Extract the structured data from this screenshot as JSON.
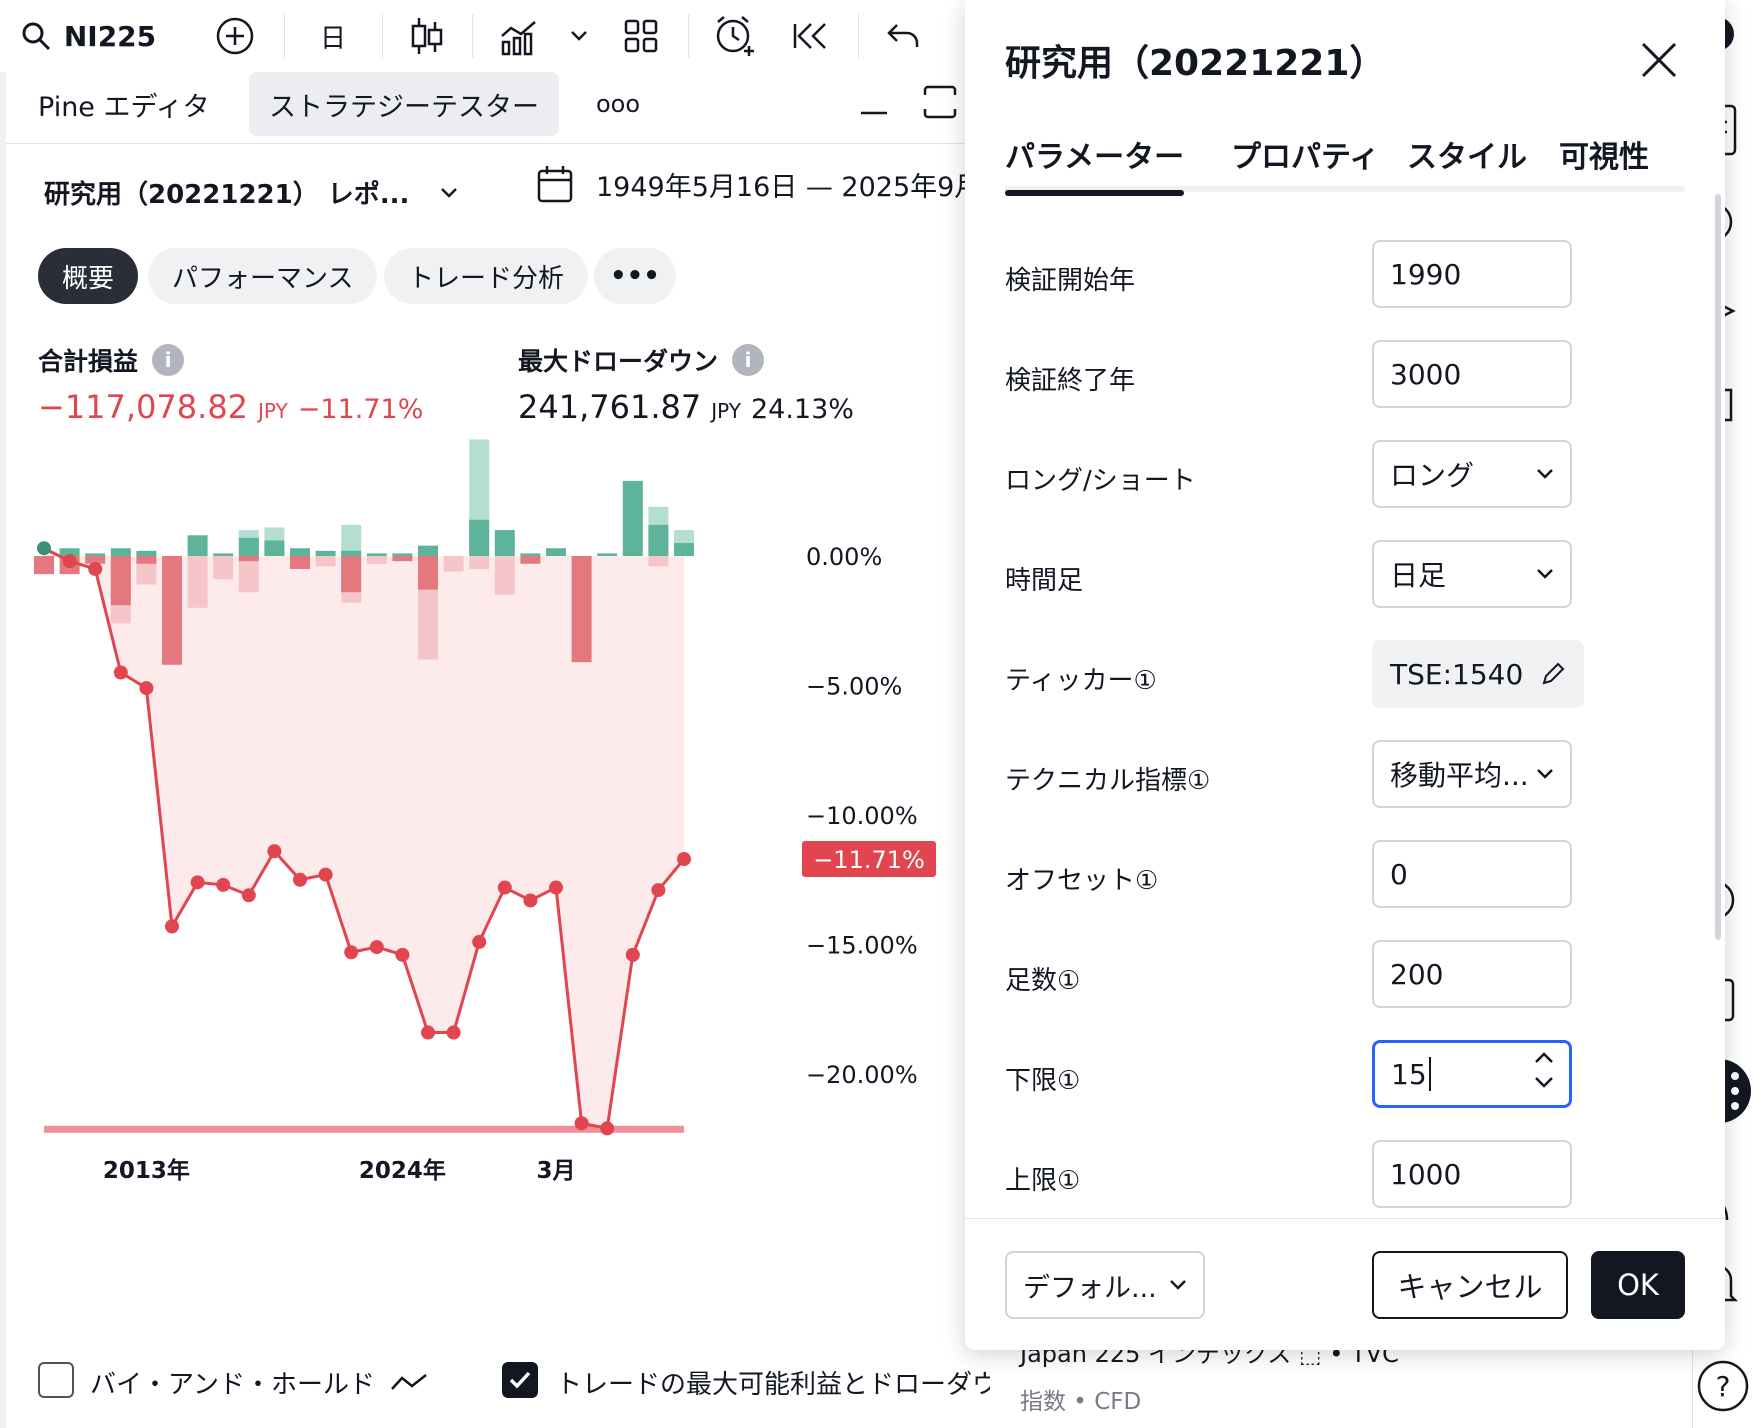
{
  "toolbar": {
    "symbol": "NI225",
    "interval": "日"
  },
  "left_tabs": {
    "pine_editor": "Pine エディタ",
    "strategy_tester": "ストラテジーテスター",
    "more": "ooo"
  },
  "report": {
    "title": "研究用（20221221） レポ...",
    "date_range": "1949年5月16日 — 2025年9月"
  },
  "pills": [
    "概要",
    "パフォーマンス",
    "トレード分析",
    "•••"
  ],
  "metrics": {
    "total_pnl": {
      "label": "合計損益",
      "value": "−117,078.82",
      "unit": "JPY",
      "pct": "−11.71%"
    },
    "max_drawdown": {
      "label": "最大ドローダウン",
      "value": "241,761.87",
      "unit": "JPY",
      "pct": "24.13%"
    }
  },
  "chart_data": {
    "type": "line",
    "y_ticks": [
      {
        "value": 0,
        "label": "0.00%"
      },
      {
        "value": -5,
        "label": "−5.00%"
      },
      {
        "value": -10,
        "label": "−10.00%"
      },
      {
        "value": -15,
        "label": "−15.00%"
      },
      {
        "value": -20,
        "label": "−20.00%"
      }
    ],
    "ylim": [
      -22.5,
      3.5
    ],
    "x_ticks": [
      {
        "index": 4,
        "label": "2013年"
      },
      {
        "index": 14,
        "label": "2024年"
      },
      {
        "index": 20,
        "label": "3月"
      }
    ],
    "last_value_label": "−11.71%",
    "equity": [
      0.3,
      -0.2,
      -0.5,
      -4.5,
      -5.1,
      -14.3,
      -12.6,
      -12.7,
      -13.1,
      -11.4,
      -12.5,
      -12.3,
      -15.3,
      -15.1,
      -15.4,
      -18.4,
      -18.4,
      -14.9,
      -12.8,
      -13.3,
      -12.8,
      -21.9,
      -22.1,
      -15.4,
      -12.9,
      -11.7
    ],
    "bars": [
      {
        "pos": 0,
        "neg": -0.7
      },
      {
        "pos": 0.3,
        "neg": -0.7
      },
      {
        "pos": 0.1,
        "neg": -0.3
      },
      {
        "pos": 0.3,
        "neg": -1.9,
        "neg_light": -2.6
      },
      {
        "pos": 0.2,
        "neg": -0.3,
        "neg_light": -1.1
      },
      {
        "pos": 0,
        "neg": -4.2
      },
      {
        "pos": 0.8,
        "neg_light": -2.0
      },
      {
        "pos": 0.1,
        "neg_light": -0.9
      },
      {
        "pos": 0.7,
        "pos_light": 1.0,
        "neg": -0.2,
        "neg_light": -1.4
      },
      {
        "pos": 0.6,
        "pos_light": 1.1
      },
      {
        "pos": 0.3,
        "neg": -0.5
      },
      {
        "pos": 0.2,
        "neg_light": -0.4
      },
      {
        "pos": 0.2,
        "pos_light": 1.2,
        "neg": -1.4,
        "neg_light": -1.8
      },
      {
        "pos": 0.1,
        "neg_light": -0.3
      },
      {
        "pos": 0.1,
        "neg": -0.2
      },
      {
        "pos": 0.4,
        "neg": -1.3,
        "neg_light": -4.0
      },
      {
        "neg_light": -0.6
      },
      {
        "pos": 1.4,
        "pos_light": 4.5,
        "neg_light": -0.5
      },
      {
        "pos": 1.0,
        "neg_light": -1.5
      },
      {
        "pos": 0.1,
        "neg": -0.3
      },
      {
        "pos": 0.3
      },
      {
        "neg": -4.1
      },
      {
        "pos": 0.1
      },
      {
        "pos": 2.9
      },
      {
        "pos": 1.2,
        "pos_light": 1.9,
        "neg_light": -0.4
      },
      {
        "pos": 0.5,
        "pos_light": 1.0
      }
    ],
    "colors": {
      "line": "#e04550",
      "fill": "#fdeaea",
      "pos": "#5db49b",
      "pos_light": "#b5ded3",
      "neg": "#e3797f",
      "neg_light": "#f4c6c9",
      "dd_line": "#f08f97"
    }
  },
  "bottom": {
    "buy_hold": "バイ・アンド・ホールド",
    "max_profit": "トレードの最大可能利益とドローダウ"
  },
  "behind": {
    "instrument": "Japan 225 インデックス  ⬚ • TVC",
    "type": "指数 • CFD"
  },
  "dialog": {
    "title": "研究用（20221221）",
    "tabs": [
      "パラメーター",
      "プロパティ",
      "スタイル",
      "可視性"
    ],
    "params": [
      {
        "label": "検証開始年",
        "value": "1990",
        "kind": "input"
      },
      {
        "label": "検証終了年",
        "value": "3000",
        "kind": "input"
      },
      {
        "label": "ロング/ショート",
        "value": "ロング",
        "kind": "select"
      },
      {
        "label": "時間足",
        "value": "日足",
        "kind": "select"
      },
      {
        "label": "ティッカー①",
        "value": "TSE:1540",
        "kind": "ticker"
      },
      {
        "label": "テクニカル指標①",
        "value": "移動平均...",
        "kind": "select"
      },
      {
        "label": "オフセット①",
        "value": "0",
        "kind": "input"
      },
      {
        "label": "足数①",
        "value": "200",
        "kind": "input"
      },
      {
        "label": "下限①",
        "value": "15",
        "kind": "focus"
      },
      {
        "label": "上限①",
        "value": "1000",
        "kind": "input"
      }
    ],
    "footer": {
      "defaults": "デフォル...",
      "cancel": "キャンセル",
      "ok": "OK"
    }
  }
}
